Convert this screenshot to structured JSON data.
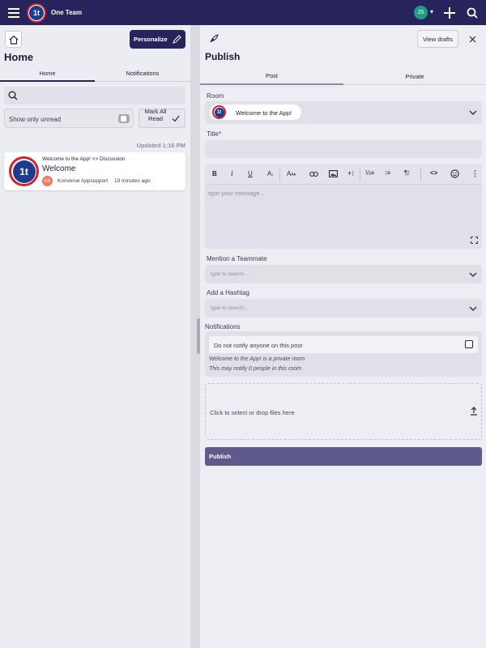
{
  "app": {
    "name": "One Team",
    "logo_letter": "1t",
    "avatar_initials": "JS"
  },
  "left": {
    "title": "Home",
    "personalize_label": "Personalize",
    "tabs": [
      {
        "label": "Home"
      },
      {
        "label": "Notifications"
      }
    ],
    "show_only_unread_label": "Show only unread",
    "mark_all_read_label": "Mark All Read",
    "updated_label": "Updated 1:16 PM",
    "feed": [
      {
        "breadcrumb": "Welcome to the App! >> Discussion",
        "title": "Welcome",
        "author_initials": "KA",
        "author": "Konverse Appsupport",
        "time": "19 minutes ago"
      }
    ]
  },
  "publish": {
    "title": "Publish",
    "view_drafts_label": "View drafts",
    "tabs": [
      {
        "label": "Post"
      },
      {
        "label": "Private"
      }
    ],
    "room_label": "Room",
    "room_value": "Welcome to the App!",
    "title_label": "Title*",
    "title_value": "",
    "editor_placeholder": "type your message...",
    "mention_label": "Mention a Teammate",
    "mention_placeholder": "type to search...",
    "hashtag_label": "Add a Hashtag",
    "hashtag_placeholder": "type to search...",
    "notifications_label": "Notifications",
    "do_not_notify_label": "Do not notify anyone on this post",
    "private_note": "Welcome to the App! is a private room",
    "notify_note": "This may notify 0 people in this room",
    "dropzone_label": "Click to select or drop files here",
    "publish_button": "Publish"
  },
  "colors": {
    "topbar": "#26245a",
    "accent": "#5f5a8c",
    "avatar": "#1e9c86",
    "author_badge": "#ef7d63"
  }
}
